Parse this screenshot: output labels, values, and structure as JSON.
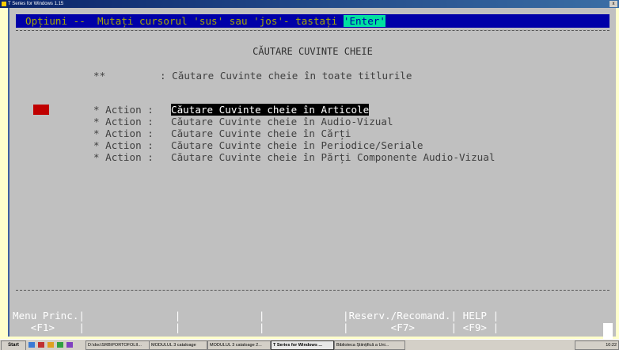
{
  "window": {
    "title": "T Series for Windows 1.15",
    "close_label": "x"
  },
  "terminal": {
    "prompt_text": "Opțiuni --  Mutați cursorul 'sus' sau 'jos'- tastați ",
    "prompt_enter": "'Enter'",
    "heading": "CĂUTARE CUVINTE CHEIE",
    "all_titles": {
      "marker": "**",
      "text": ": Căutare Cuvinte cheie în toate titlurile"
    },
    "actions": [
      {
        "label": "* Action :",
        "text": "Căutare Cuvinte cheie în Articole",
        "selected": true
      },
      {
        "label": "* Action :",
        "text": "Căutare Cuvinte cheie în Audio-Vizual"
      },
      {
        "label": "* Action :",
        "text": "Căutare Cuvinte cheie în Cărți"
      },
      {
        "label": "* Action :",
        "text": "Căutare Cuvinte cheie în Periodice/Seriale"
      },
      {
        "label": "* Action :",
        "text": "Căutare Cuvinte cheie în Părți Componente Audio-Vizual"
      }
    ],
    "cursor_marker": "=>",
    "fkeys_row1": "Menu Princ.|               |             |             |Reserv./Recomand.| HELP |",
    "fkeys_row2": "   <F1>    |               |             |             |       <F7>      | <F9> |"
  },
  "taskbar": {
    "start_label": "Start",
    "tasks": [
      "D:\\doc\\SRB\\PORTOFOLII...",
      "MODULUL 3 cataloage",
      "MODULUL 3 cataloage 2...",
      "T Series for Windows ...",
      "Biblioteca Științifică a Uni..."
    ],
    "clock": "10:22"
  },
  "colors": {
    "terminal_bg": "#c0c0c0",
    "prompt_bar": "#0000a8",
    "prompt_text": "#a8a800",
    "enter_highlight": "#00e0a0",
    "cursor_marker": "#c00000",
    "desktop": "#ffffcc"
  }
}
